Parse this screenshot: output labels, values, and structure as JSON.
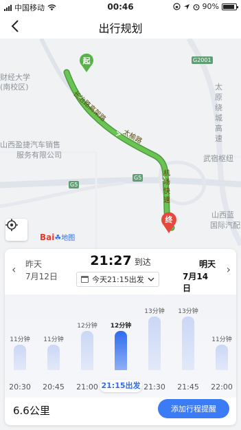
{
  "status_bar": {
    "carrier": "中国移动",
    "time": "00:46",
    "battery": "90%",
    "battery_level": 0.9
  },
  "nav": {
    "back_icon": "chevron-left-icon",
    "title": "出行规划"
  },
  "map": {
    "labels": {
      "place_1": "财经大学",
      "place_2": "(南校区)",
      "place_3": "山西盈捷汽车销售",
      "place_4": "服务有限公司",
      "place_5": "太",
      "place_6": "原",
      "place_7": "绕",
      "place_8": "城",
      "place_9": "高",
      "place_10": "速",
      "place_11": "武宿枢纽",
      "place_12": "山西蓝",
      "place_13": "国际汽配"
    },
    "road_badges": [
      "G2001",
      "G5",
      "G5"
    ],
    "road_names": [
      "长治路高架路",
      "太榆路",
      "机场快速"
    ],
    "start_marker": "起",
    "end_marker": "终",
    "logo": "Bai",
    "logo_sub": "地图",
    "route_color": "#5cb848"
  },
  "plan": {
    "prev_day": {
      "label": "昨天",
      "date": "7月12日"
    },
    "arrival": {
      "time": "21:27",
      "suffix": "到达"
    },
    "depart_selector": "今天21:15出发",
    "next_day": {
      "label": "明天",
      "date": "7月14日"
    },
    "chart_data": {
      "type": "bar",
      "categories": [
        "20:30",
        "20:45",
        "21:00",
        "21:15出发",
        "21:30",
        "21:45",
        "22:00"
      ],
      "values": [
        11,
        11,
        12,
        12,
        13,
        13,
        11
      ],
      "value_labels": [
        "11分钟",
        "11分钟",
        "12分钟",
        "12分钟",
        "13分钟",
        "13分钟",
        "11分钟"
      ],
      "selected_index": 3,
      "ylim": [
        10,
        13
      ],
      "selected_color": "#2f6bee",
      "bar_color": "#cad7f5"
    },
    "distance": "6.6公里",
    "remind_button": "添加行程提醒"
  }
}
